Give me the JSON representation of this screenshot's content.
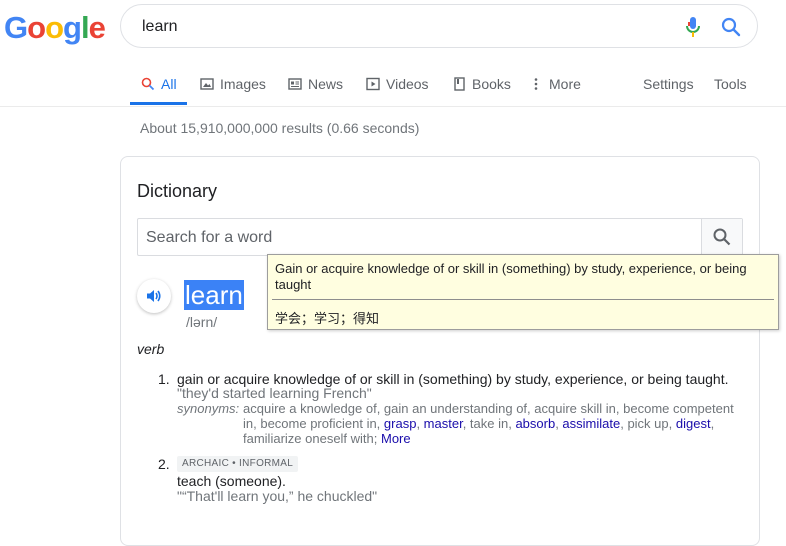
{
  "logo": {
    "letters": [
      "G",
      "o",
      "o",
      "g",
      "l",
      "e"
    ],
    "colors": [
      "#4285f4",
      "#ea4335",
      "#fbbc05",
      "#4285f4",
      "#34a853",
      "#ea4335"
    ]
  },
  "search": {
    "query": "learn"
  },
  "tabs": [
    {
      "label": "All",
      "icon": "search-icon",
      "active": true
    },
    {
      "label": "Images",
      "icon": "image-icon"
    },
    {
      "label": "News",
      "icon": "news-icon"
    },
    {
      "label": "Videos",
      "icon": "play-icon"
    },
    {
      "label": "Books",
      "icon": "book-icon"
    },
    {
      "label": "More",
      "icon": "more-vert-icon"
    },
    {
      "label": "Settings"
    },
    {
      "label": "Tools"
    }
  ],
  "stats": "About 15,910,000,000 results (0.66 seconds)",
  "dictionary": {
    "title": "Dictionary",
    "search_placeholder": "Search for a word",
    "word": "learn",
    "phonetic": "/lərn/",
    "pos": "verb",
    "definitions": [
      {
        "num": "1.",
        "text": "gain or acquire knowledge of or skill in (something) by study, experience, or being taught.",
        "example": "\"they'd started learning French\"",
        "synonyms_label": "synonyms:",
        "synonyms_plain_1": "acquire a knowledge of, gain an understanding of, acquire skill in, become competent in, become proficient in, ",
        "syn_link_1": "grasp",
        "sep_1": ", ",
        "syn_link_2": "master",
        "plain_2": ", take in, ",
        "syn_link_3": "absorb",
        "sep_3": ", ",
        "syn_link_4": "assimilate",
        "plain_3": ", pick up, ",
        "syn_link_5": "digest",
        "plain_4": ", familiarize oneself with;  ",
        "more": "More"
      },
      {
        "num": "2.",
        "badge": "ARCHAIC • INFORMAL",
        "text": "teach (someone).",
        "example": "\"“That'll learn you,” he chuckled\""
      }
    ]
  },
  "tooltip": {
    "definition": "Gain or acquire knowledge of or skill in (something) by study, experience, or being taught",
    "translation": "学会；学习；得知"
  },
  "colors": {
    "accent": "#1a73e8",
    "link": "#1a0dab",
    "tooltip_bg": "#fffee0",
    "highlight": "#3b82f6"
  }
}
